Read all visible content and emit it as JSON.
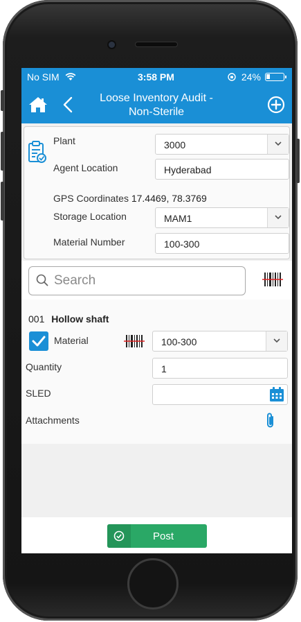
{
  "status_bar": {
    "carrier": "No SIM",
    "time": "3:58 PM",
    "battery": "24%",
    "battery_level": 0.24
  },
  "nav": {
    "title_line1": "Loose Inventory Audit -",
    "title_line2": "Non-Sterile"
  },
  "header_form": {
    "plant_label": "Plant",
    "plant_value": "3000",
    "agent_location_label": "Agent Location",
    "agent_location_value": "Hyderabad",
    "gps_label": "GPS Coordinates",
    "gps_value": "17.4469, 78.3769",
    "storage_location_label": "Storage Location",
    "storage_location_value": "MAM1",
    "material_number_label": "Material Number",
    "material_number_value": "100-300"
  },
  "search": {
    "placeholder": "Search"
  },
  "item": {
    "number": "001",
    "name": "Hollow shaft",
    "material_checked": true,
    "material_label": "Material",
    "material_value": "100-300",
    "quantity_label": "Quantity",
    "quantity_value": "1",
    "sled_label": "SLED",
    "sled_value": "",
    "attachments_label": "Attachments"
  },
  "footer": {
    "post_label": "Post"
  },
  "colors": {
    "primary": "#1a8fd6",
    "post_green": "#2aa866"
  },
  "icons": [
    "home-icon",
    "back-icon",
    "add-circle-icon",
    "clipboard-icon",
    "chevron-down-icon",
    "search-icon",
    "barcode-icon",
    "checkmark-icon",
    "calendar-icon",
    "paperclip-icon",
    "check-circle-icon",
    "wifi-icon"
  ]
}
